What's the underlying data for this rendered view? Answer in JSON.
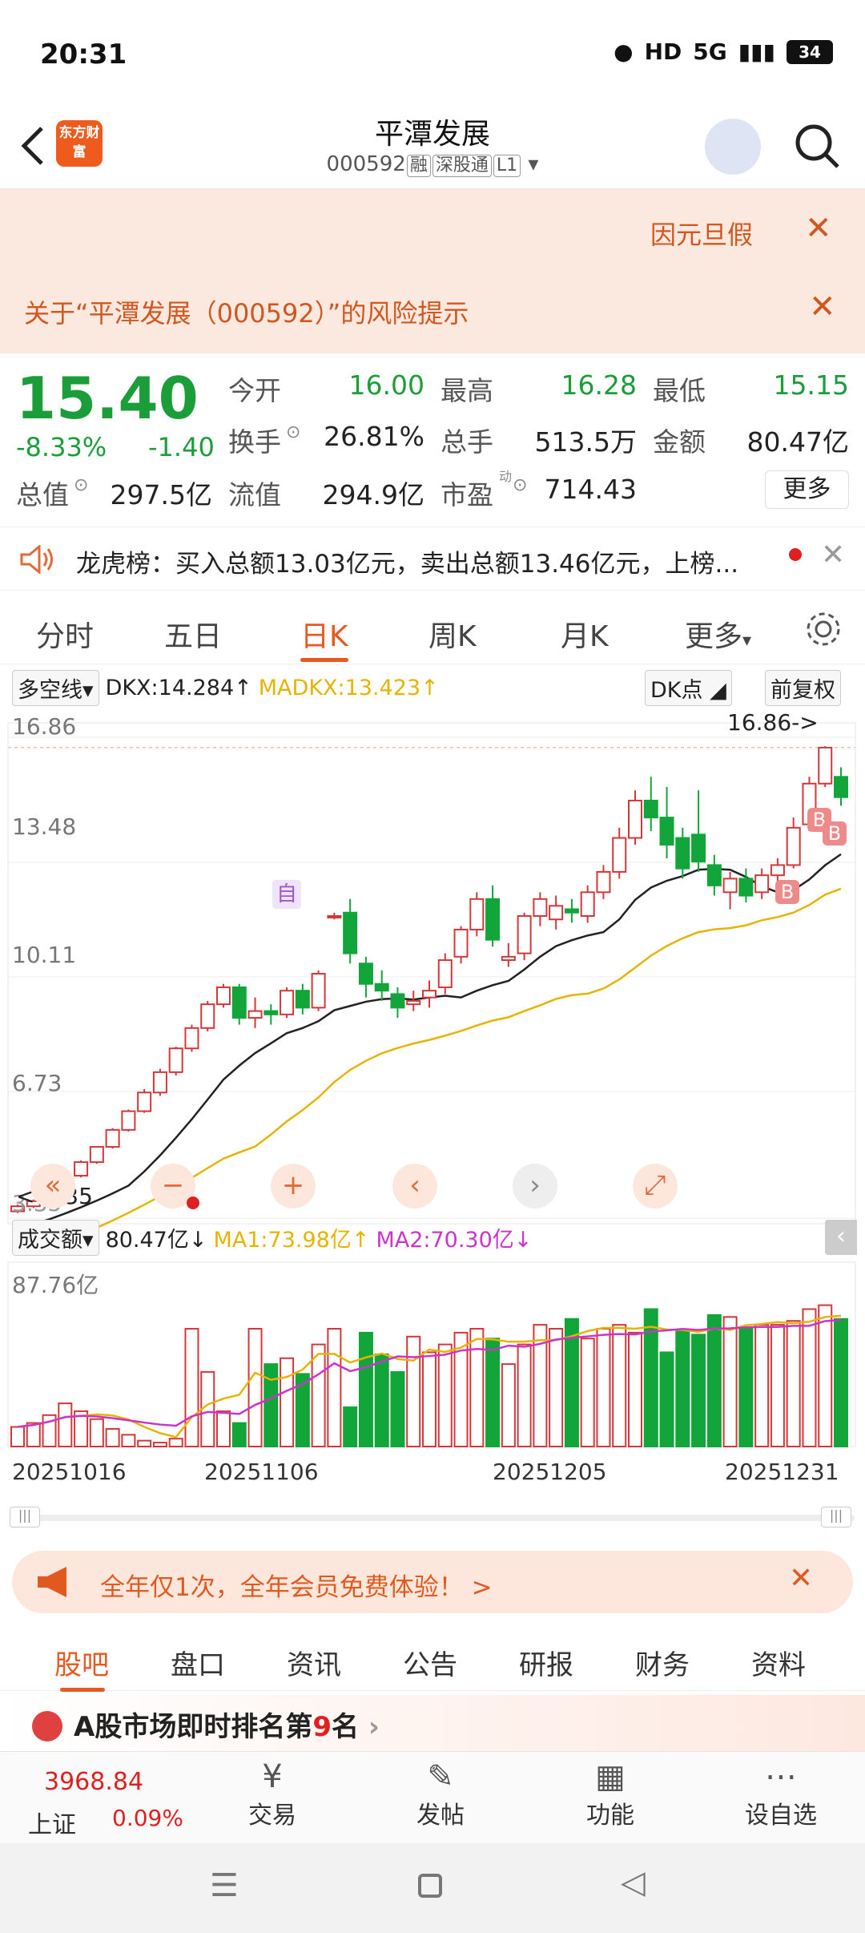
{
  "status": {
    "time": "20:31",
    "network": "5G",
    "hd": "HD",
    "battery": "34"
  },
  "header": {
    "brand": "东方财富",
    "title": "平潭发展",
    "code": "000592",
    "tags": [
      "融",
      "深股通",
      "L1"
    ]
  },
  "notices": {
    "ticker": "因元旦假",
    "risk": "关于“平潭发展（000592）”的风险提示"
  },
  "quote": {
    "price": "15.40",
    "change_pct": "-8.33%",
    "change": "-1.40",
    "open_label": "今开",
    "open": "16.00",
    "high_label": "最高",
    "high": "16.28",
    "low_label": "最低",
    "low": "15.15",
    "turnover_label": "换手",
    "turnover": "26.81%",
    "volume_label": "总手",
    "volume": "513.5万",
    "amount_label": "金额",
    "amount": "80.47亿",
    "mcap_label": "总值",
    "mcap": "297.5亿",
    "float_label": "流值",
    "float": "294.9亿",
    "pe_label": "市盈",
    "pe_sup": "动",
    "pe": "714.43",
    "more": "更多"
  },
  "dragon": {
    "text": "龙虎榜：买入总额13.03亿元，卖出总额13.46亿元，上榜..."
  },
  "chart_tabs": [
    "分时",
    "五日",
    "日K",
    "周K",
    "月K",
    "更多"
  ],
  "indicator": {
    "name": "多空线",
    "dkx": "DKX:14.284",
    "madkx": "MADKX:13.423",
    "dk": "DK点",
    "fq": "前复权"
  },
  "volume_indicator": {
    "name": "成交额",
    "val": "80.47亿",
    "ma1": "MA1:73.98亿",
    "ma2": "MA2:70.30亿",
    "max": "87.76亿"
  },
  "chart_data": {
    "type": "candlestick",
    "price_axis": [
      "16.86",
      "13.48",
      "10.11",
      "6.73",
      "3.35"
    ],
    "date_labels": [
      "20251016",
      "20251106",
      "20251205",
      "20251231"
    ],
    "marks": {
      "high": "16.86->",
      "low": "<-3.35",
      "zi": "自",
      "b": "B"
    },
    "candles": [
      [
        3.2,
        3.35,
        3.15,
        3.4
      ],
      [
        3.35,
        3.5,
        3.3,
        3.55
      ],
      [
        3.5,
        3.85,
        3.45,
        3.85
      ],
      [
        3.85,
        4.25,
        3.8,
        4.25
      ],
      [
        4.25,
        4.65,
        4.2,
        4.7
      ],
      [
        4.65,
        5.1,
        4.6,
        5.1
      ],
      [
        5.1,
        5.6,
        5.05,
        5.65
      ],
      [
        5.6,
        6.15,
        5.55,
        6.2
      ],
      [
        6.15,
        6.7,
        6.1,
        6.8
      ],
      [
        6.7,
        7.3,
        6.6,
        7.4
      ],
      [
        7.3,
        8.0,
        7.2,
        8.05
      ],
      [
        8.0,
        8.6,
        7.9,
        8.7
      ],
      [
        8.6,
        9.3,
        8.5,
        9.4
      ],
      [
        9.3,
        9.8,
        9.2,
        9.9
      ],
      [
        9.8,
        8.9,
        8.7,
        9.9
      ],
      [
        8.9,
        9.1,
        8.6,
        9.5
      ],
      [
        9.1,
        9.0,
        8.7,
        9.3
      ],
      [
        9.0,
        9.7,
        8.9,
        9.8
      ],
      [
        9.7,
        9.2,
        9.0,
        9.9
      ],
      [
        9.2,
        10.2,
        9.1,
        10.3
      ],
      [
        11.9,
        11.9,
        11.8,
        12.0
      ],
      [
        12.0,
        10.8,
        10.5,
        12.4
      ],
      [
        10.5,
        9.9,
        9.5,
        10.7
      ],
      [
        9.9,
        9.7,
        9.4,
        10.3
      ],
      [
        9.6,
        9.2,
        8.9,
        9.8
      ],
      [
        9.3,
        9.4,
        9.1,
        9.7
      ],
      [
        9.5,
        9.7,
        9.2,
        10.0
      ],
      [
        9.8,
        10.6,
        9.6,
        10.8
      ],
      [
        10.7,
        11.5,
        10.5,
        11.6
      ],
      [
        11.5,
        12.4,
        11.3,
        12.6
      ],
      [
        12.4,
        11.2,
        11.0,
        12.8
      ],
      [
        10.6,
        10.7,
        10.4,
        11.1
      ],
      [
        10.8,
        11.9,
        10.6,
        12.0
      ],
      [
        11.9,
        12.4,
        11.6,
        12.6
      ],
      [
        11.8,
        12.2,
        11.5,
        12.5
      ],
      [
        12.1,
        12.0,
        11.7,
        12.4
      ],
      [
        11.9,
        12.6,
        11.7,
        12.8
      ],
      [
        12.6,
        13.2,
        12.4,
        13.4
      ],
      [
        13.2,
        14.2,
        13.0,
        14.5
      ],
      [
        14.2,
        15.3,
        14.0,
        15.6
      ],
      [
        15.3,
        14.8,
        14.4,
        16.0
      ],
      [
        14.8,
        14.0,
        13.6,
        15.7
      ],
      [
        14.2,
        13.3,
        13.0,
        14.5
      ],
      [
        14.3,
        13.5,
        13.2,
        15.6
      ],
      [
        13.4,
        12.8,
        12.5,
        13.7
      ],
      [
        12.6,
        13.0,
        12.1,
        13.2
      ],
      [
        13.0,
        12.5,
        12.3,
        13.3
      ],
      [
        12.6,
        13.1,
        12.4,
        13.3
      ],
      [
        13.1,
        13.4,
        12.9,
        13.6
      ],
      [
        13.4,
        14.5,
        13.3,
        14.8
      ],
      [
        14.6,
        15.8,
        14.4,
        16.0
      ],
      [
        15.8,
        16.86,
        15.7,
        16.9
      ],
      [
        16.0,
        15.4,
        15.15,
        16.28
      ]
    ],
    "volume": [
      10,
      12,
      16,
      22,
      18,
      14,
      9,
      6,
      3,
      2,
      4,
      60,
      38,
      18,
      12,
      60,
      42,
      45,
      37,
      52,
      60,
      20,
      58,
      47,
      38,
      56,
      48,
      52,
      58,
      60,
      55,
      42,
      52,
      62,
      60,
      65,
      55,
      60,
      62,
      58,
      70,
      48,
      59,
      57,
      67,
      66,
      60,
      62,
      62,
      64,
      70,
      72,
      65
    ]
  },
  "promo": {
    "text": "全年仅1次，全年会员免费体验！ >"
  },
  "bottom_tabs": [
    "股吧",
    "盘口",
    "资讯",
    "公告",
    "研报",
    "财务",
    "资料"
  ],
  "rank": {
    "text_pre": "A股市场即时排名第",
    "num": "9",
    "text_post": "名"
  },
  "footer": {
    "index_val": "3968.84",
    "index_name": "上证",
    "index_pct": "0.09%",
    "items": [
      "交易",
      "发帖",
      "功能",
      "设自选"
    ]
  }
}
